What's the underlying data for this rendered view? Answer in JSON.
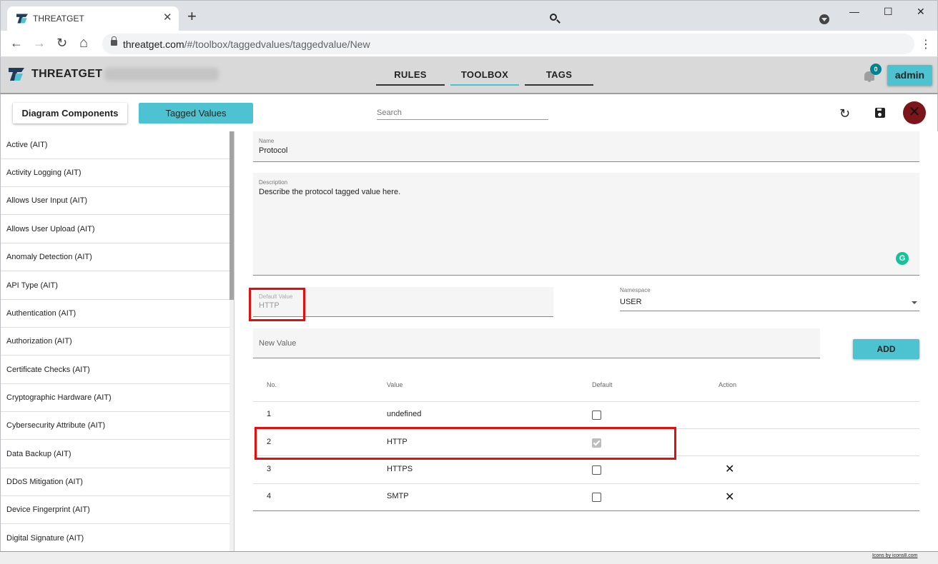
{
  "browser": {
    "tab_title": "THREATGET",
    "tab_close": "✕",
    "new_tab": "+",
    "url_domain": "threatget.com",
    "url_path": "/#/toolbox/taggedvalues/taggedvalue/New",
    "back": "←",
    "forward": "→",
    "reload": "↻",
    "home": "⌂",
    "menu": "⋮",
    "minimize": "—",
    "maximize": "☐",
    "close": "✕"
  },
  "app": {
    "title": "THREATGET",
    "nav": [
      "RULES",
      "TOOLBOX",
      "TAGS"
    ],
    "active_nav": "TOOLBOX",
    "notification_count": "0",
    "user_button": "admin"
  },
  "subbar": {
    "diagram_components": "Diagram Components",
    "tagged_values": "Tagged Values",
    "search_placeholder": "Search",
    "close_glyph": "✕",
    "undo_glyph": "↻"
  },
  "sidebar": {
    "items": [
      "Active (AIT)",
      "Activity Logging (AIT)",
      "Allows User Input (AIT)",
      "Allows User Upload (AIT)",
      "Anomaly Detection (AIT)",
      "API Type (AIT)",
      "Authentication (AIT)",
      "Authorization (AIT)",
      "Certificate Checks (AIT)",
      "Cryptographic Hardware (AIT)",
      "Cybersecurity Attribute (AIT)",
      "Data Backup (AIT)",
      "DDoS Mitigation (AIT)",
      "Device Fingerprint (AIT)",
      "Digital Signature (AIT)"
    ]
  },
  "form": {
    "name_label": "Name",
    "name_value": "Protocol",
    "description_label": "Description",
    "description_value": "Describe the protocol tagged value here.",
    "grammarly_glyph": "G",
    "default_value_label": "Default Value",
    "default_value": "HTTP",
    "namespace_label": "Namespace",
    "namespace_value": "USER",
    "new_value_placeholder": "New Value",
    "add_button": "ADD"
  },
  "table": {
    "headers": [
      "No.",
      "Value",
      "Default",
      "Action"
    ],
    "rows": [
      {
        "no": "1",
        "value": "undefined",
        "default": false,
        "deletable": false
      },
      {
        "no": "2",
        "value": "HTTP",
        "default": true,
        "deletable": false
      },
      {
        "no": "3",
        "value": "HTTPS",
        "default": false,
        "deletable": true
      },
      {
        "no": "4",
        "value": "SMTP",
        "default": false,
        "deletable": true
      }
    ],
    "delete_glyph": "✕"
  },
  "footer": {
    "credit": "Icons by icons8.com"
  },
  "colors": {
    "accent": "#4dc3d1",
    "highlight": "#e01010",
    "close_button": "#7b1519",
    "badge": "#00838f"
  }
}
